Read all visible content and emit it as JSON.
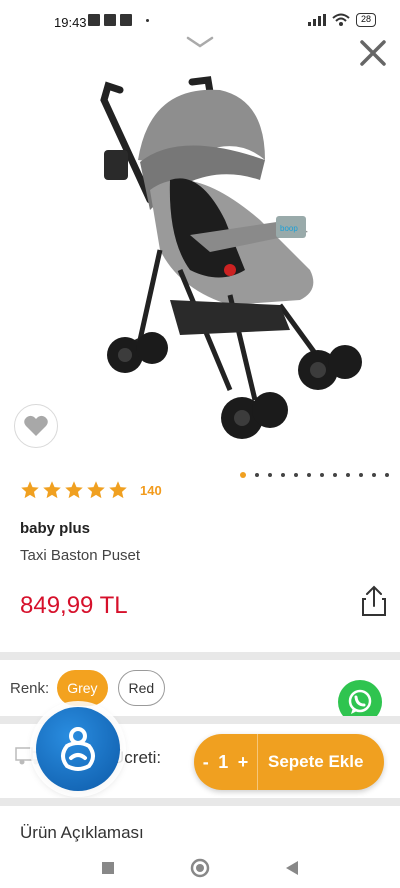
{
  "status_bar": {
    "time": "19:43",
    "battery": "28"
  },
  "product": {
    "brand": "baby plus",
    "name": "Taxi Baston Puset",
    "price": "849,99 TL",
    "rating_count": "140",
    "rating_stars": 5,
    "image_label": "boop",
    "carousel_total": 12,
    "carousel_active_index": 0
  },
  "variant": {
    "label": "Renk:",
    "options": [
      "Grey",
      "Red"
    ],
    "selected": "Grey"
  },
  "shipping": {
    "label": "Ücreti:",
    "label_after_fab": "Ü"
  },
  "cart": {
    "minus": "-",
    "quantity": "1",
    "plus": "+",
    "add_label": "Sepete Ekle"
  },
  "description": {
    "title": "Ürün Açıklaması"
  },
  "colors": {
    "accent": "#f0a020",
    "price": "#d6102b",
    "whatsapp": "#2fc44f",
    "fab": "#1a74c8"
  },
  "icons": [
    "chevron-down-icon",
    "close-icon",
    "heart-icon",
    "star-icon",
    "share-icon",
    "whatsapp-icon",
    "truck-icon",
    "baby-app-icon",
    "nav-square-icon",
    "nav-home-icon",
    "nav-back-icon"
  ]
}
